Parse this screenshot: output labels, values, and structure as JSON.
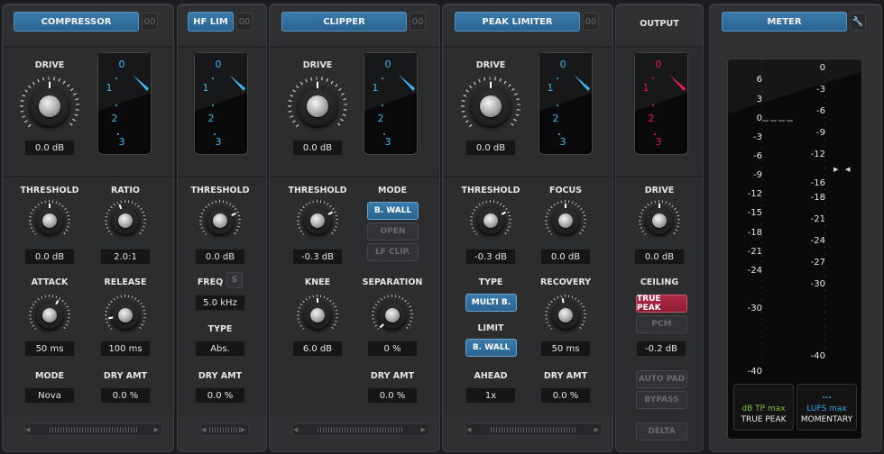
{
  "colors": {
    "accent": "#2e6a95",
    "dial_blue": "#3fb7ef",
    "dial_red": "#f0184a",
    "true_peak_green": "#7fc43a",
    "lufs_blue": "#3aa7e6"
  },
  "dial_scale": [
    "0",
    "1",
    "2",
    "3"
  ],
  "oo_label": "00",
  "compressor": {
    "title": "COMPRESSOR",
    "drive_label": "DRIVE",
    "drive": "0.0 dB",
    "threshold_label": "THRESHOLD",
    "threshold": "0.0 dB",
    "ratio_label": "RATIO",
    "ratio": "2.0:1",
    "attack_label": "ATTACK",
    "attack": "50 ms",
    "release_label": "RELEASE",
    "release": "100 ms",
    "mode_label": "MODE",
    "mode": "Nova",
    "dry_label": "DRY AMT",
    "dry": "0.0 %"
  },
  "hflim": {
    "title": "HF LIM",
    "threshold_label": "THRESHOLD",
    "threshold": "0.0 dB",
    "freq_label": "FREQ",
    "s_label": "S",
    "freq": "5.0 kHz",
    "type_label": "TYPE",
    "type": "Abs.",
    "dry_label": "DRY AMT",
    "dry": "0.0 %"
  },
  "clipper": {
    "title": "CLIPPER",
    "drive_label": "DRIVE",
    "drive": "0.0 dB",
    "threshold_label": "THRESHOLD",
    "threshold": "-0.3 dB",
    "mode_label": "MODE",
    "modes": [
      "B. WALL",
      "OPEN",
      "LF CLIP."
    ],
    "knee_label": "KNEE",
    "knee": "6.0 dB",
    "separation_label": "SEPARATION",
    "separation": "0 %",
    "dry_label": "DRY AMT",
    "dry": "0.0 %"
  },
  "peak": {
    "title": "PEAK LIMITER",
    "drive_label": "DRIVE",
    "drive": "0.0 dB",
    "threshold_label": "THRESHOLD",
    "threshold": "-0.3 dB",
    "focus_label": "FOCUS",
    "focus": "0.0 dB",
    "type_label": "TYPE",
    "type": "MULTI B.",
    "limit_label": "LIMIT",
    "limit": "B. WALL",
    "recovery_label": "RECOVERY",
    "recovery": "50 ms",
    "ahead_label": "AHEAD",
    "ahead": "1x",
    "dry_label": "DRY AMT",
    "dry": "0.0 %"
  },
  "output": {
    "title": "OUTPUT",
    "drive_label": "DRIVE",
    "drive": "0.0 dB",
    "ceiling_label": "CEILING",
    "true_peak": "TRUE PEAK",
    "pcm": "PCM",
    "ceiling": "-0.2 dB",
    "auto_pad": "AUTO PAD",
    "bypass": "BYPASS",
    "delta": "DELTA"
  },
  "meter": {
    "title": "METER",
    "left_scale": [
      "6",
      "3",
      "0",
      "-3",
      "-6",
      "-9",
      "-12",
      "-15",
      "-18",
      "-21",
      "-24",
      "-30",
      "-40"
    ],
    "right_scale": [
      "0",
      "-3",
      "-6",
      "-9",
      "-12",
      "-16",
      "-18",
      "-21",
      "-24",
      "-27",
      "-30",
      "-40"
    ],
    "tp_unit": "dB TP max",
    "tp_label": "TRUE PEAK",
    "lufs_value": "...",
    "lufs_unit": "LUFS max",
    "lufs_label": "MOMENTARY"
  }
}
